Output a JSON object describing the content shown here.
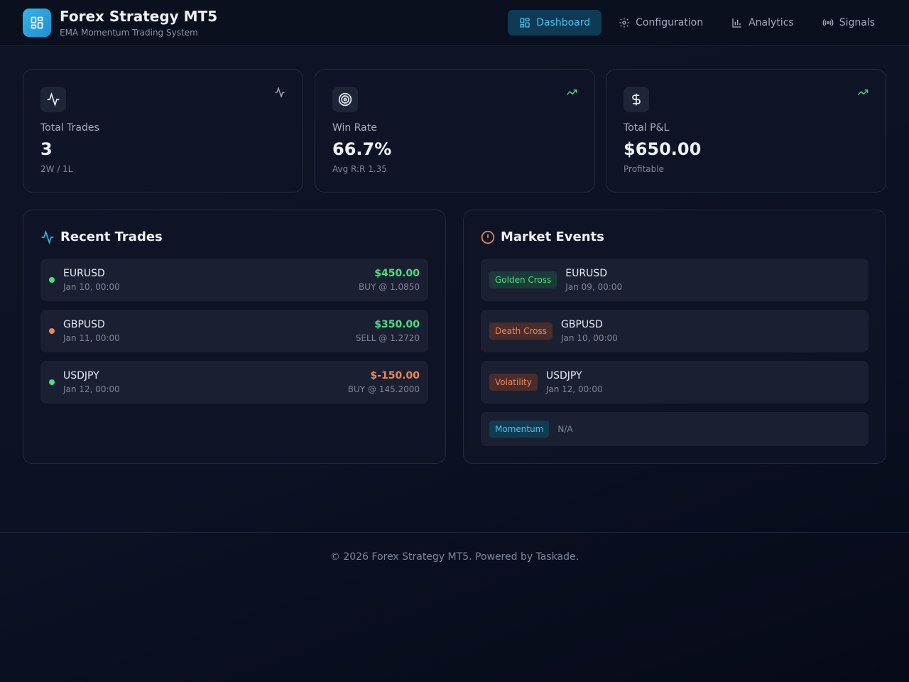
{
  "app": {
    "title": "Forex Strategy MT5",
    "subtitle": "EMA Momentum Trading System",
    "logo_icon": "dashboard-grid-icon",
    "accent": "#38b2e8"
  },
  "nav": {
    "items": [
      {
        "label": "Dashboard",
        "icon": "dashboard-grid-icon",
        "active": true
      },
      {
        "label": "Configuration",
        "icon": "gear-icon",
        "active": false
      },
      {
        "label": "Analytics",
        "icon": "bar-chart-icon",
        "active": false
      },
      {
        "label": "Signals",
        "icon": "radio-signal-icon",
        "active": false
      }
    ]
  },
  "stats": [
    {
      "label": "Total Trades",
      "value": "3",
      "sub": "2W / 1L",
      "icon": "activity-icon",
      "trend_icon": "activity-icon",
      "trend_color": "#a4acbd"
    },
    {
      "label": "Win Rate",
      "value": "66.7%",
      "sub": "Avg R:R 1.35",
      "icon": "target-icon",
      "trend_icon": "trending-up-icon",
      "trend_color": "#4ade80"
    },
    {
      "label": "Total P&L",
      "value": "$650.00",
      "sub": "Profitable",
      "icon": "dollar-icon",
      "trend_icon": "trending-up-icon",
      "trend_color": "#4ade80"
    }
  ],
  "recent_trades": {
    "title": "Recent Trades",
    "icon": "activity-icon",
    "items": [
      {
        "pair": "EURUSD",
        "date": "Jan 10, 00:00",
        "pnl": "$450.00",
        "detail": "BUY @ 1.0850",
        "dot_color": "#4ade80",
        "pnl_color": "#4ade80"
      },
      {
        "pair": "GBPUSD",
        "date": "Jan 11, 00:00",
        "pnl": "$350.00",
        "detail": "SELL @ 1.2720",
        "dot_color": "#f0855a",
        "pnl_color": "#4ade80"
      },
      {
        "pair": "USDJPY",
        "date": "Jan 12, 00:00",
        "pnl": "$-150.00",
        "detail": "BUY @ 145.2000",
        "dot_color": "#4ade80",
        "pnl_color": "#f0855a"
      }
    ]
  },
  "market_events": {
    "title": "Market Events",
    "icon": "alert-circle-icon",
    "items": [
      {
        "badge": "Golden Cross",
        "pair": "EURUSD",
        "date": "Jan 09, 00:00",
        "badge_color": "#4ade80",
        "badge_bg": "#1c3a38"
      },
      {
        "badge": "Death Cross",
        "pair": "GBPUSD",
        "date": "Jan 10, 00:00",
        "badge_color": "#f0855a",
        "badge_bg": "#4a2d2a"
      },
      {
        "badge": "Volatility",
        "pair": "USDJPY",
        "date": "Jan 12, 00:00",
        "badge_color": "#f0855a",
        "badge_bg": "#4a2d2a"
      },
      {
        "badge": "Momentum",
        "na": "N/A",
        "badge_color": "#4cc0f0",
        "badge_bg": "#123a52"
      }
    ]
  },
  "footer": {
    "text": "© 2026 Forex Strategy MT5. Powered by Taskade."
  }
}
